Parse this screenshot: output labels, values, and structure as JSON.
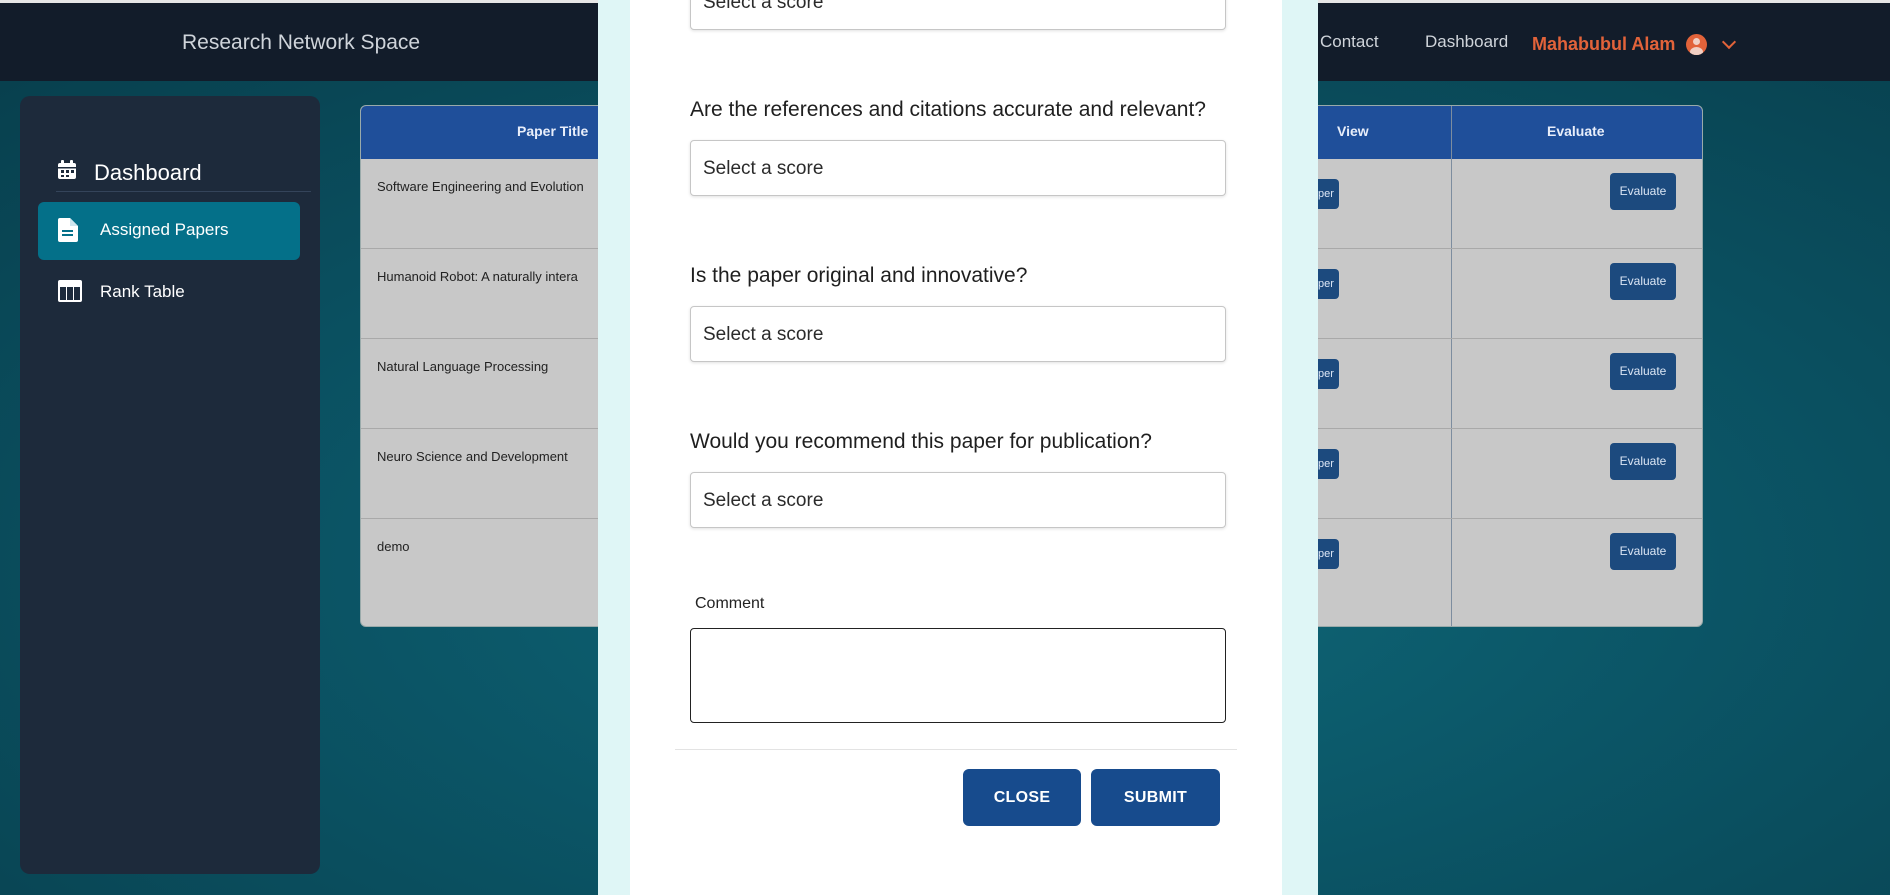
{
  "header": {
    "brand": "Research Network Space",
    "nav": [
      "Contact",
      "Dashboard"
    ],
    "user_name": "Mahabubul Alam"
  },
  "sidebar": {
    "title": "Dashboard",
    "items": [
      {
        "label": "Assigned Papers",
        "icon": "document-icon",
        "active": true
      },
      {
        "label": "Rank Table",
        "icon": "table-icon",
        "active": false
      }
    ]
  },
  "table": {
    "columns": [
      "Paper Title",
      "View",
      "Evaluate"
    ],
    "rows": [
      {
        "title": "Software Engineering and Evolution",
        "view": "per",
        "evaluate": "Evaluate"
      },
      {
        "title": "Humanoid Robot: A naturally intera",
        "view": "per",
        "evaluate": "Evaluate"
      },
      {
        "title": "Natural Language Processing",
        "view": "per",
        "evaluate": "Evaluate"
      },
      {
        "title": "Neuro Science and Development",
        "view": "per",
        "evaluate": "Evaluate"
      },
      {
        "title": "demo",
        "view": "per",
        "evaluate": "Evaluate"
      }
    ]
  },
  "modal": {
    "questions": [
      {
        "label": "",
        "placeholder": "Select a score"
      },
      {
        "label": "Are the references and citations accurate and relevant?",
        "placeholder": "Select a score"
      },
      {
        "label": "Is the paper original and innovative?",
        "placeholder": "Select a score"
      },
      {
        "label": "Would you recommend this paper for publication?",
        "placeholder": "Select a score"
      }
    ],
    "comment_label": "Comment",
    "comment_value": "",
    "close_label": "CLOSE",
    "submit_label": "SUBMIT"
  },
  "colors": {
    "accent": "#174b8d",
    "active_nav": "#047089",
    "user": "#e2633a"
  }
}
